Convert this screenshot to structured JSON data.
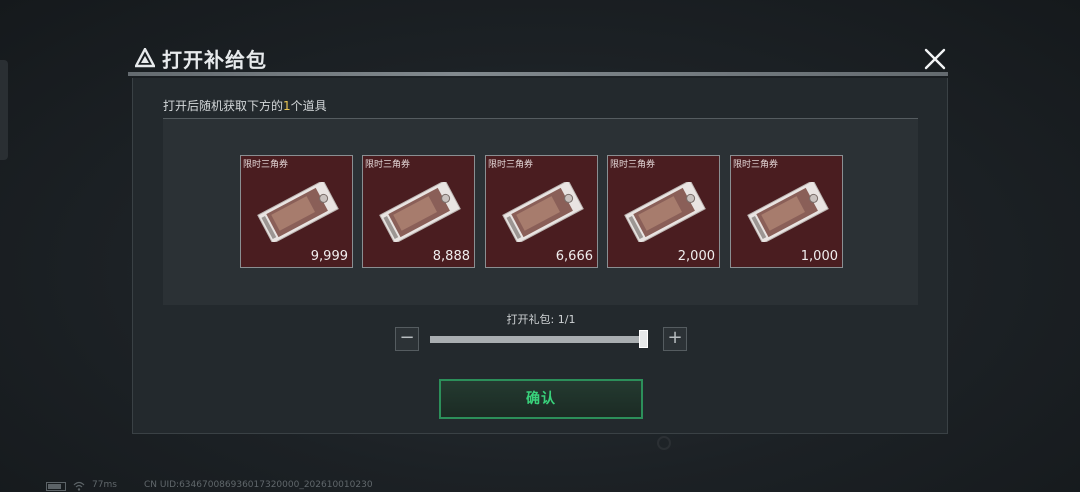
{
  "dialog": {
    "title": "打开补给包",
    "subtitle_prefix": "打开后随机获取下方的",
    "subtitle_count": "1",
    "subtitle_suffix": "个道具"
  },
  "items": [
    {
      "label": "限时三角券",
      "count": "9,999"
    },
    {
      "label": "限时三角券",
      "count": "8,888"
    },
    {
      "label": "限时三角券",
      "count": "6,666"
    },
    {
      "label": "限时三角券",
      "count": "2,000"
    },
    {
      "label": "限时三角券",
      "count": "1,000"
    }
  ],
  "stepper": {
    "label": "打开礼包: 1/1",
    "minus": "−",
    "plus": "+",
    "current": 1,
    "max": 1
  },
  "confirm_label": "确认",
  "footer": {
    "latency": "77ms",
    "uid": "CN UID:634670086936017320000_202610010230"
  },
  "colors": {
    "accent_green": "#39d27b",
    "highlight_yellow": "#e9c454",
    "item_bg": "#4a1d20"
  }
}
